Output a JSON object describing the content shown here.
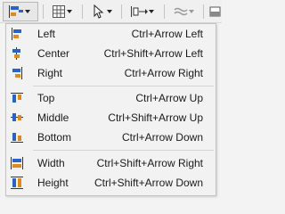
{
  "colors": {
    "icon_blue": "#2b62c6",
    "icon_orange": "#e08a1e",
    "icon_dark": "#333333"
  },
  "toolbar": {
    "buttons": [
      {
        "name": "align-button",
        "icon": "align-icon"
      },
      {
        "name": "grid-button",
        "icon": "grid-icon"
      },
      {
        "name": "select-button",
        "icon": "cursor-icon"
      },
      {
        "name": "distribute-button",
        "icon": "distribute-icon"
      },
      {
        "name": "line-style-button",
        "icon": "wave-icon"
      },
      {
        "name": "fill-button",
        "icon": "fill-icon"
      }
    ]
  },
  "menu": {
    "items": [
      {
        "label": "Left",
        "shortcut": "Ctrl+Arrow Left",
        "icon": "align-left-icon"
      },
      {
        "label": "Center",
        "shortcut": "Ctrl+Shift+Arrow Left",
        "icon": "align-center-icon"
      },
      {
        "label": "Right",
        "shortcut": "Ctrl+Arrow Right",
        "icon": "align-right-icon"
      },
      {
        "label": "Top",
        "shortcut": "Ctrl+Arrow Up",
        "icon": "align-top-icon"
      },
      {
        "label": "Middle",
        "shortcut": "Ctrl+Shift+Arrow Up",
        "icon": "align-middle-icon"
      },
      {
        "label": "Bottom",
        "shortcut": "Ctrl+Arrow Down",
        "icon": "align-bottom-icon"
      },
      {
        "label": "Width",
        "shortcut": "Ctrl+Shift+Arrow Right",
        "icon": "same-width-icon"
      },
      {
        "label": "Height",
        "shortcut": "Ctrl+Shift+Arrow Down",
        "icon": "same-height-icon"
      }
    ]
  }
}
